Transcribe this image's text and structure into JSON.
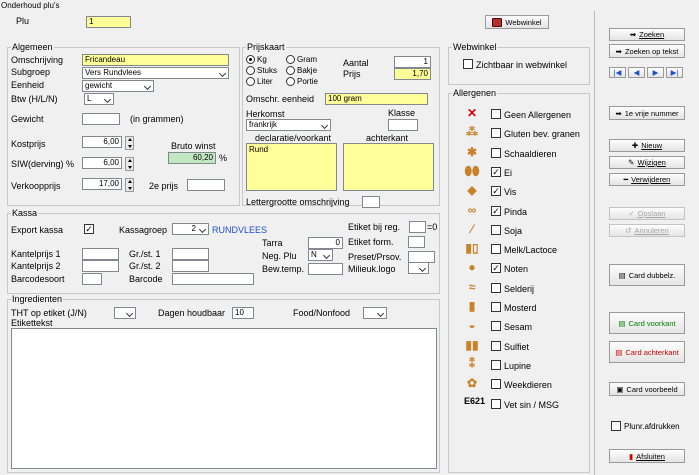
{
  "window_title": "Onderhoud plu's",
  "plu": {
    "label": "Plu",
    "value": "1"
  },
  "webwinkel_button": "Webwinkel",
  "algemeen": {
    "title": "Algemeen",
    "omschrijving": {
      "label": "Omschrijving",
      "value": "Fricandeau"
    },
    "subgroep": {
      "label": "Subgroep",
      "value": "Vers Rundvlees"
    },
    "eenheid": {
      "label": "Eenheid",
      "value": "gewicht"
    },
    "btw": {
      "label": "Btw (H/L/N)",
      "value": "L"
    },
    "gewicht": {
      "label": "Gewicht",
      "value": "",
      "suffix": "(in grammen)"
    },
    "kostprijs": {
      "label": "Kostprijs",
      "value": "6,00"
    },
    "siw": {
      "label": "SIW(derving) %",
      "value": "6,00"
    },
    "bruto_winst": {
      "label": "Bruto winst",
      "value": "60,20",
      "suffix": "%"
    },
    "verkoopprijs": {
      "label": "Verkoopprijs",
      "value": "17,00"
    },
    "tweede_prijs": {
      "label": "2e prijs",
      "value": ""
    }
  },
  "prijskaart": {
    "title": "Prijskaart",
    "units": [
      "Kg",
      "Gram",
      "Stuks",
      "Bakje",
      "Liter",
      "Portie"
    ],
    "selected_unit": "Kg",
    "aantal": {
      "label": "Aantal",
      "value": "1"
    },
    "prijs": {
      "label": "Prijs",
      "value": "1,70"
    },
    "omschr_eenheid": {
      "label": "Omschr. eenheid",
      "value": "100 gram"
    },
    "herkomst": {
      "label": "Herkomst",
      "value": "frankrijk"
    },
    "klasse": {
      "label": "Klasse",
      "value": ""
    },
    "declaratie": {
      "label": "declaratie/voorkant",
      "value": "Rund"
    },
    "achterkant": {
      "label": "achterkant",
      "value": ""
    },
    "lettergrootte": {
      "label": "Lettergrootte omschrijving",
      "value": ""
    }
  },
  "webwinkel": {
    "title": "Webwinkel",
    "zichtbaar": {
      "label": "Zichtbaar in webwinkel",
      "checked": false
    }
  },
  "allergenen": {
    "title": "Allergenen",
    "items": [
      {
        "label": "Geen Allergenen",
        "checked": false,
        "icon": "no-allergen-icon"
      },
      {
        "label": "Gluten bev. granen",
        "checked": false,
        "icon": "grain-icon"
      },
      {
        "label": "Schaaldieren",
        "checked": false,
        "icon": "crab-icon"
      },
      {
        "label": "Ei",
        "checked": true,
        "icon": "egg-icon"
      },
      {
        "label": "Vis",
        "checked": true,
        "icon": "fish-icon"
      },
      {
        "label": "Pinda",
        "checked": true,
        "icon": "peanut-icon"
      },
      {
        "label": "Soja",
        "checked": false,
        "icon": "soy-icon"
      },
      {
        "label": "Melk/Lactoce",
        "checked": false,
        "icon": "milk-icon"
      },
      {
        "label": "Noten",
        "checked": true,
        "icon": "nuts-icon"
      },
      {
        "label": "Selderij",
        "checked": false,
        "icon": "celery-icon"
      },
      {
        "label": "Mosterd",
        "checked": false,
        "icon": "mustard-icon"
      },
      {
        "label": "Sesam",
        "checked": false,
        "icon": "sesame-icon"
      },
      {
        "label": "Sulfiet",
        "checked": false,
        "icon": "sulfite-icon"
      },
      {
        "label": "Lupine",
        "checked": false,
        "icon": "lupine-icon"
      },
      {
        "label": "Weekdieren",
        "checked": false,
        "icon": "mollusc-icon"
      },
      {
        "label": "Vet sin / MSG",
        "checked": false,
        "icon": "E621"
      }
    ]
  },
  "kassa": {
    "title": "Kassa",
    "export_kassa": {
      "label": "Export kassa",
      "checked": true
    },
    "kassagroep": {
      "label": "Kassagroep",
      "value": "2",
      "name": "RUNDVLEES"
    },
    "etiket_bij_reg": {
      "label": "Etiket bij reg.",
      "value": "",
      "suffix": "=0"
    },
    "kantelprijs1": {
      "label": "Kantelprijs 1",
      "value": ""
    },
    "grst1": {
      "label": "Gr./st. 1",
      "value": ""
    },
    "tarra": {
      "label": "Tarra",
      "value": "0"
    },
    "etiket_form": {
      "label": "Etiket form.",
      "value": ""
    },
    "kantelprijs2": {
      "label": "Kantelprijs 2",
      "value": ""
    },
    "grst2": {
      "label": "Gr./st. 2",
      "value": ""
    },
    "neg_plu": {
      "label": "Neg. Plu",
      "value": "N"
    },
    "preset": {
      "label": "Preset/Prsov.",
      "value": ""
    },
    "barcodesoort": {
      "label": "Barcodesoort",
      "value": ""
    },
    "barcode": {
      "label": "Barcode",
      "value": ""
    },
    "bew_temp": {
      "label": "Bew.temp.",
      "value": ""
    },
    "milieuk_logo": {
      "label": "Milieuk.logo",
      "value": ""
    }
  },
  "ingredienten": {
    "title": "Ingredienten",
    "tht": {
      "label": "THT op etiket (J/N)",
      "value": ""
    },
    "dagen_houdbaar": {
      "label": "Dagen houdbaar",
      "value": "10"
    },
    "food": {
      "label": "Food/Nonfood",
      "value": ""
    },
    "etikettekst": {
      "label": "Etikettekst",
      "value": ""
    }
  },
  "buttons": {
    "zoeken": "Zoeken",
    "zoeken_tekst": "Zoeken op tekst",
    "eerste_vrije": "1e vrije nummer",
    "nieuw": "Nieuw",
    "wijzigen": "Wijzigen",
    "verwijderen": "Verwijderen",
    "opslaan": "Opslaan",
    "annuleren": "Annuleren",
    "card_dubbelz": "Card dubbelz.",
    "card_voorkant": "Card voorkant",
    "card_achterkant": "Card achterkant",
    "card_voorbeeld": "Card voorbeeld",
    "plunr_afdrukken": "Plunr.afdrukken",
    "afsluiten": "Afsluiten"
  },
  "colors": {
    "highlight": "#ffff99",
    "winst": "#c2e8c2",
    "card_voorkant": "#008000",
    "card_achterkant": "#cc0000",
    "kassagroep": "#1e4fc9"
  }
}
